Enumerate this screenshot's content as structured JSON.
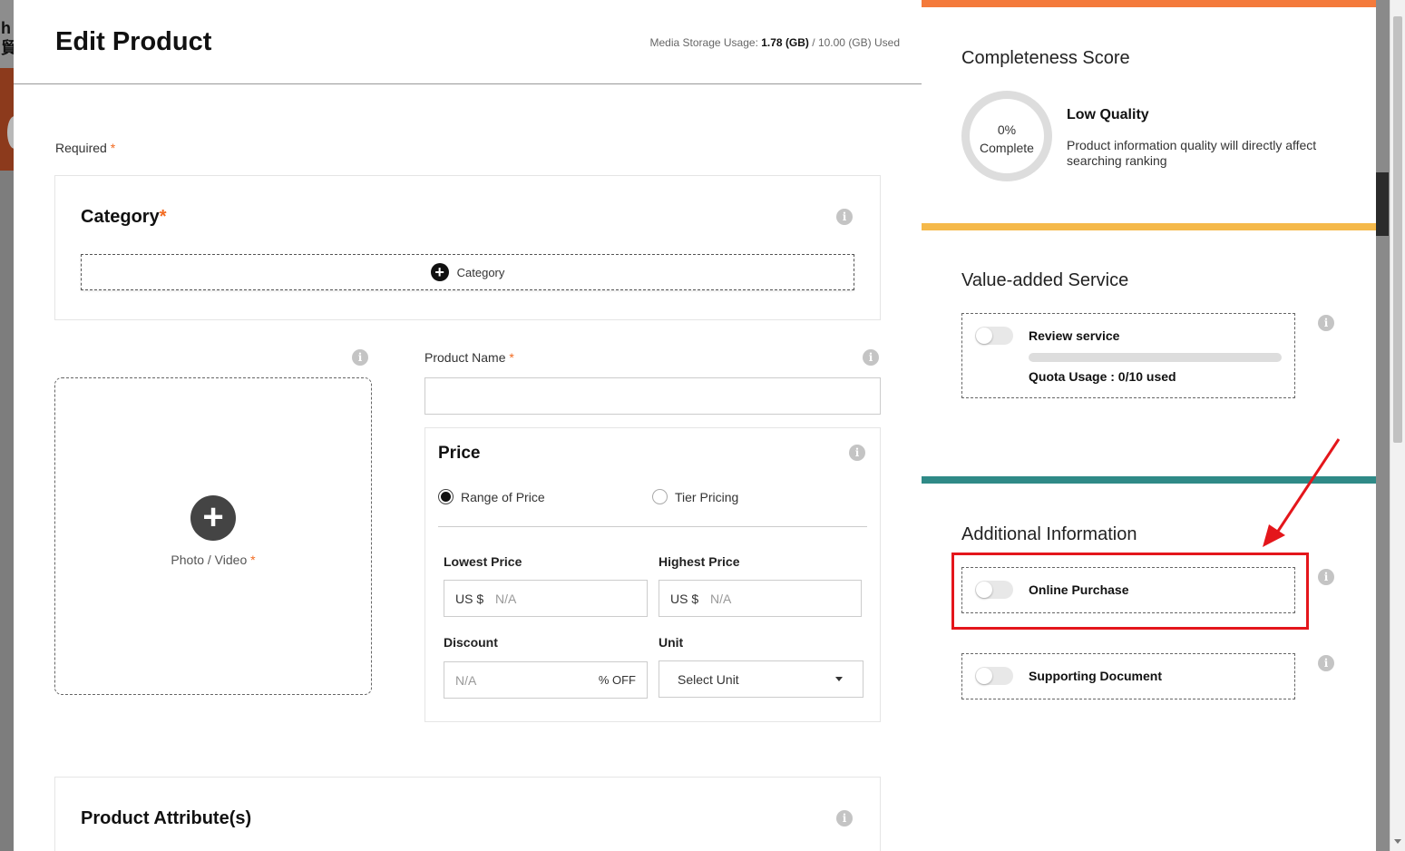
{
  "page": {
    "title": "Edit Product",
    "storage": {
      "label": "Media Storage Usage:",
      "used": "1.78 (GB)",
      "rest": "/ 10.00 (GB) Used"
    },
    "required_label": "Required",
    "required_star": "*"
  },
  "background": {
    "logo_text": "h\n貿"
  },
  "category": {
    "title": "Category",
    "star": "*",
    "button_label": "Category"
  },
  "media": {
    "label": "Photo / Video",
    "star": "*"
  },
  "product_name": {
    "label": "Product Name",
    "star": "*",
    "value": ""
  },
  "price": {
    "title": "Price",
    "options": [
      {
        "label": "Range of Price",
        "selected": true
      },
      {
        "label": "Tier Pricing",
        "selected": false
      }
    ],
    "lowest": {
      "label": "Lowest Price",
      "prefix": "US $",
      "placeholder": "N/A"
    },
    "highest": {
      "label": "Highest Price",
      "prefix": "US $",
      "placeholder": "N/A"
    },
    "discount": {
      "label": "Discount",
      "placeholder": "N/A",
      "suffix": "% OFF"
    },
    "unit": {
      "label": "Unit",
      "value": "Select Unit"
    }
  },
  "attributes": {
    "title": "Product Attribute(s)"
  },
  "side": {
    "colors": {
      "bar1": "#f47a3b",
      "bar2": "#f5b94a",
      "bar3": "#2f8a87",
      "highlight": "#e4161b"
    },
    "completeness": {
      "title": "Completeness Score",
      "percent": "0%",
      "percent_value": 0,
      "complete": "Complete",
      "quality": "Low Quality",
      "desc": "Product information quality will directly affect searching ranking"
    },
    "value_added": {
      "title": "Value-added Service",
      "review": {
        "label": "Review service",
        "enabled": false,
        "quota": "Quota Usage : 0/10 used",
        "quota_fraction": 0
      }
    },
    "additional": {
      "title": "Additional Information",
      "online_purchase": {
        "label": "Online Purchase",
        "enabled": false
      },
      "supporting_doc": {
        "label": "Supporting Document",
        "enabled": false
      }
    }
  }
}
